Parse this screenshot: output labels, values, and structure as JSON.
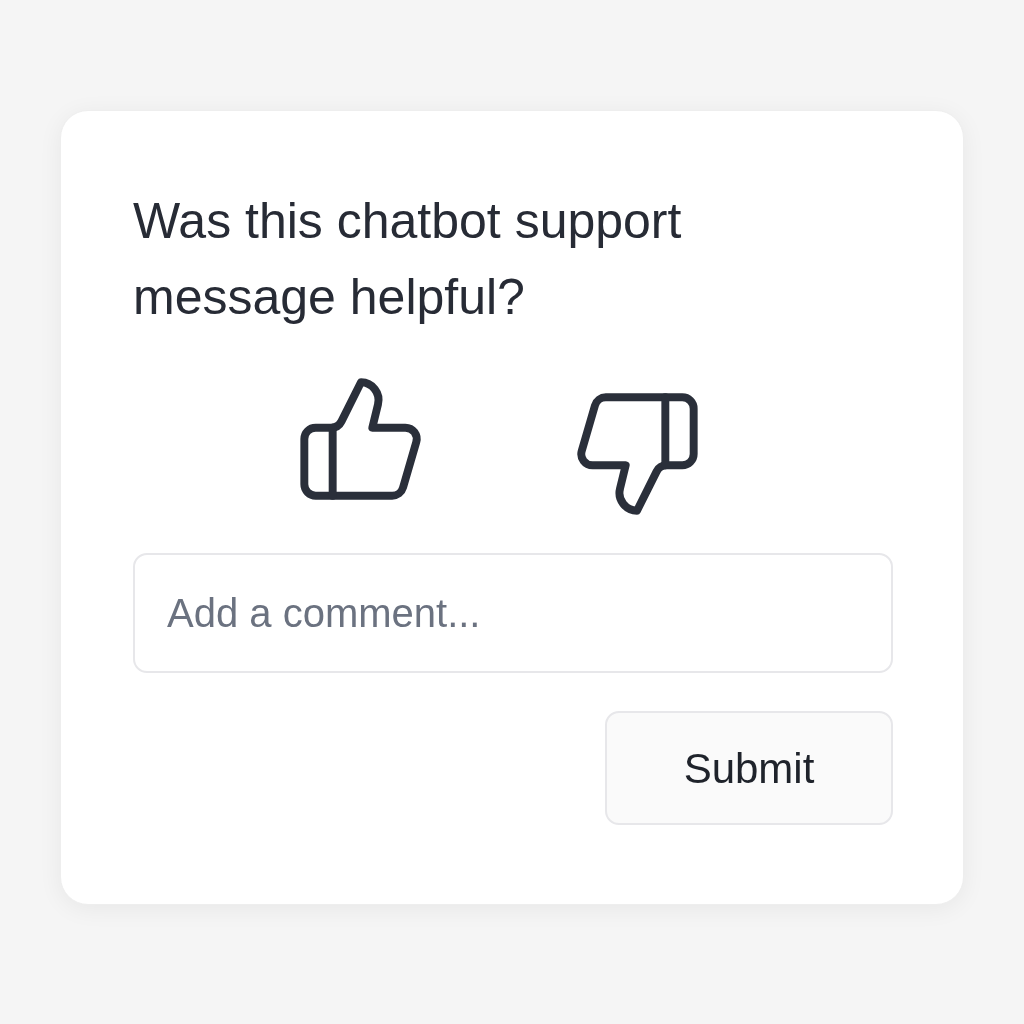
{
  "card": {
    "question": "Was this chatbot support message helpful?"
  },
  "comment": {
    "placeholder": "Add a comment..."
  },
  "submit": {
    "label": "Submit"
  }
}
